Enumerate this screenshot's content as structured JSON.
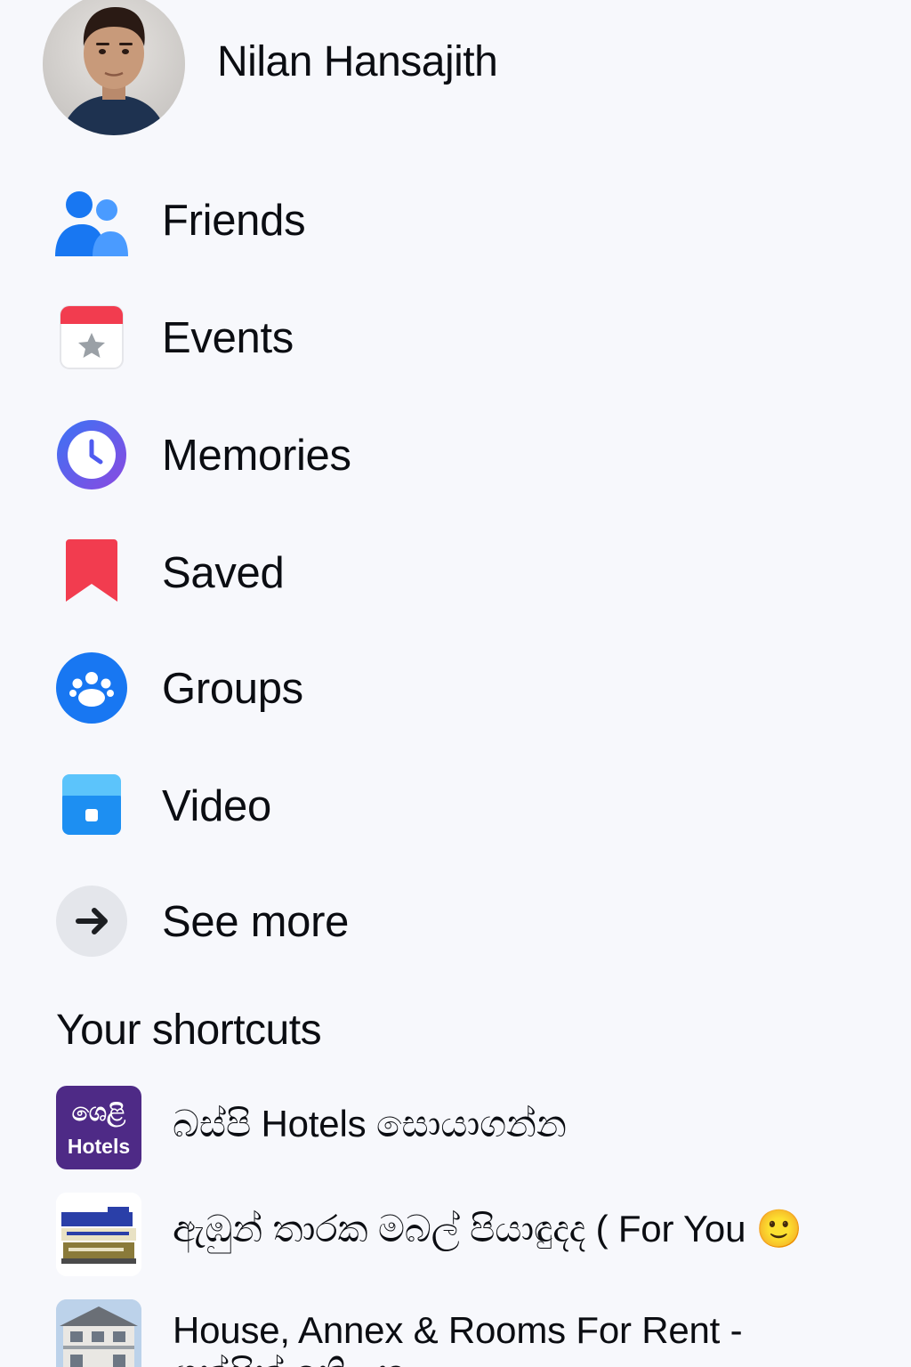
{
  "profile": {
    "name": "Nilan Hansajith"
  },
  "menu": {
    "items": [
      {
        "label": "Friends",
        "icon": "friends-icon"
      },
      {
        "label": "Events",
        "icon": "events-calendar-icon"
      },
      {
        "label": "Memories",
        "icon": "memories-clock-icon"
      },
      {
        "label": "Saved",
        "icon": "saved-bookmark-icon"
      },
      {
        "label": "Groups",
        "icon": "groups-icon"
      },
      {
        "label": "Video",
        "icon": "video-icon"
      },
      {
        "label": "See more",
        "icon": "arrow-right-icon"
      }
    ]
  },
  "shortcuts": {
    "title": "Your shortcuts",
    "items": [
      {
        "label": "බස්පි Hotels සොයාගන්න",
        "thumb_text_1": "ශෙළි",
        "thumb_text_2": "Hotels"
      },
      {
        "label": "ඇඹුන් තාරක මබල් පියාඳුදද ( For You 🙂"
      },
      {
        "label": "House, Annex & Rooms For Rent -",
        "label_line2": "ශත්පිත් ඉතිලන"
      }
    ]
  },
  "colors": {
    "background": "#f7f8fc",
    "text": "#0b0d12",
    "blue": "#1877f2",
    "red": "#f23c4f",
    "purple": "#7b4ee7",
    "video_blue": "#1da1f2",
    "grey_circle": "#e4e6eb",
    "hotel_purple": "#4e2a86"
  }
}
